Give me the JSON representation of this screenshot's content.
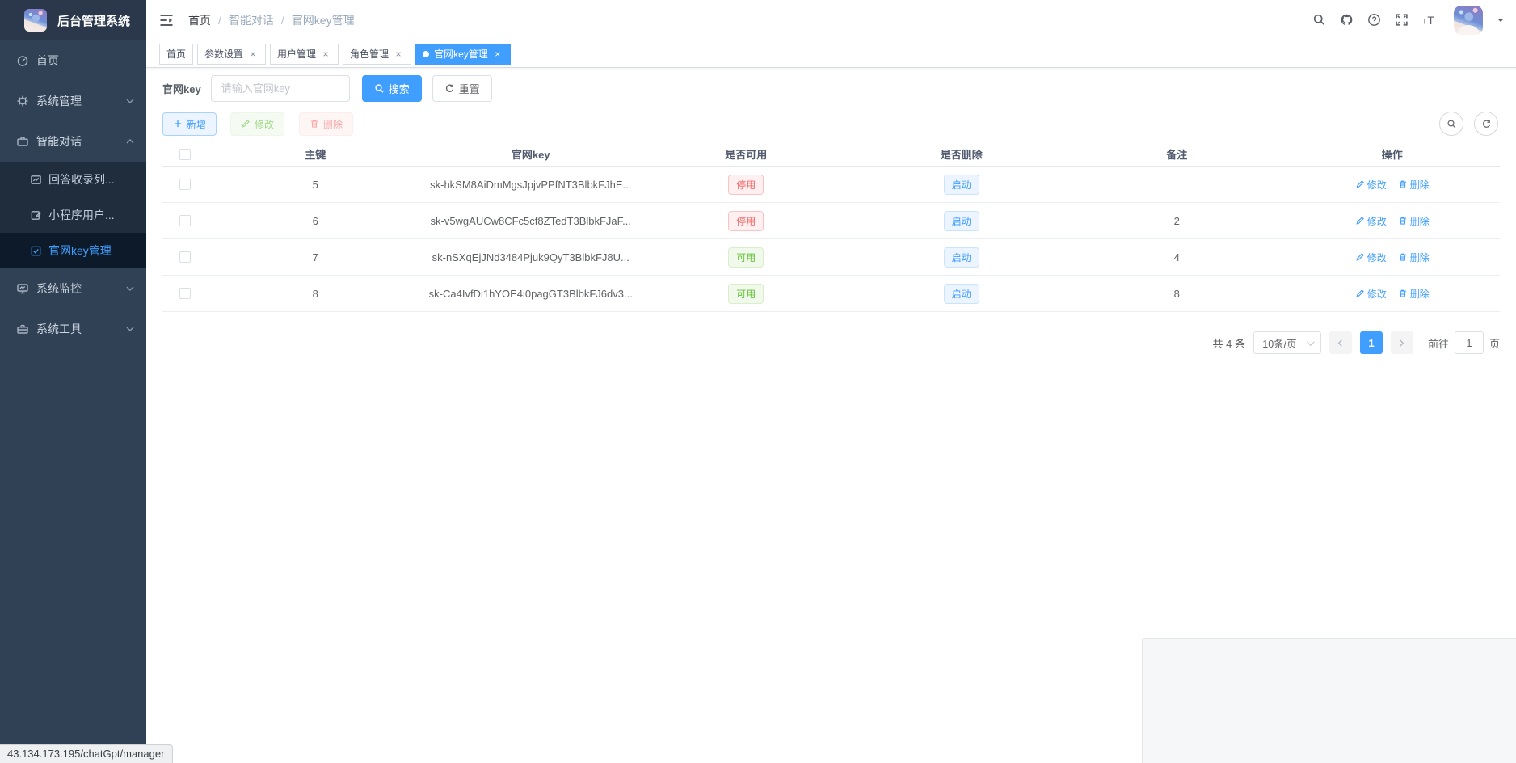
{
  "app": {
    "logo_title": "后台管理系统"
  },
  "glyphs": {
    "slash": "/",
    "close": "×"
  },
  "colors": {
    "accent": "#409eff",
    "danger": "#f56c6c",
    "success": "#67c23a",
    "sidebar_bg": "#304156",
    "submenu_bg": "#1f2d3d",
    "active_item_bg": "#0d1a2a"
  },
  "sidebar": {
    "items": [
      {
        "label": "首页",
        "icon": "dashboard-icon"
      },
      {
        "label": "系统管理",
        "icon": "gear-icon"
      },
      {
        "label": "智能对话",
        "icon": "briefcase-icon"
      },
      {
        "label": "系统监控",
        "icon": "monitor-icon"
      },
      {
        "label": "系统工具",
        "icon": "toolbox-icon"
      }
    ],
    "submenu": [
      {
        "label": "回答收录列...",
        "icon": "chart-icon"
      },
      {
        "label": "小程序用户...",
        "icon": "edit-doc-icon"
      },
      {
        "label": "官网key管理",
        "icon": "checkbox-icon"
      }
    ]
  },
  "navbar": {
    "breadcrumb": {
      "home": "首页",
      "parent": "智能对话",
      "current": "官网key管理"
    }
  },
  "tabs": [
    {
      "label": "首页"
    },
    {
      "label": "参数设置"
    },
    {
      "label": "用户管理"
    },
    {
      "label": "角色管理"
    },
    {
      "label": "官网key管理"
    }
  ],
  "search": {
    "label": "官网key",
    "placeholder": "请输入官网key",
    "search": "搜索",
    "reset": "重置"
  },
  "toolbar": {
    "add": "新增",
    "edit": "修改",
    "delete": "删除"
  },
  "table": {
    "headers": {
      "id": "主键",
      "key": "官网key",
      "available": "是否可用",
      "deleted": "是否删除",
      "remark": "备注",
      "actions": "操作"
    },
    "rows": [
      {
        "id": "5",
        "key": "sk-hkSM8AiDmMgsJpjvPPfNT3BlbkFJhE...",
        "available": "停用",
        "available_type": "danger",
        "deleted": "启动",
        "deleted_type": "info",
        "remark": "",
        "edit": "修改",
        "delete": "删除"
      },
      {
        "id": "6",
        "key": "sk-v5wgAUCw8CFc5cf8ZTedT3BlbkFJaF...",
        "available": "停用",
        "available_type": "danger",
        "deleted": "启动",
        "deleted_type": "info",
        "remark": "2",
        "edit": "修改",
        "delete": "删除"
      },
      {
        "id": "7",
        "key": "sk-nSXqEjJNd3484Pjuk9QyT3BlbkFJ8U...",
        "available": "可用",
        "available_type": "success",
        "deleted": "启动",
        "deleted_type": "info",
        "remark": "4",
        "edit": "修改",
        "delete": "删除"
      },
      {
        "id": "8",
        "key": "sk-Ca4IvfDi1hYOE4i0pagGT3BlbkFJ6dv3...",
        "available": "可用",
        "available_type": "success",
        "deleted": "启动",
        "deleted_type": "info",
        "remark": "8",
        "edit": "修改",
        "delete": "删除"
      }
    ]
  },
  "pagination": {
    "total": "共 4 条",
    "page_size": "10条/页",
    "page": "1",
    "jump_label": "前往",
    "jump_value": "1",
    "jump_unit": "页"
  },
  "statusbar": {
    "link": "43.134.173.195/chatGpt/manager"
  }
}
